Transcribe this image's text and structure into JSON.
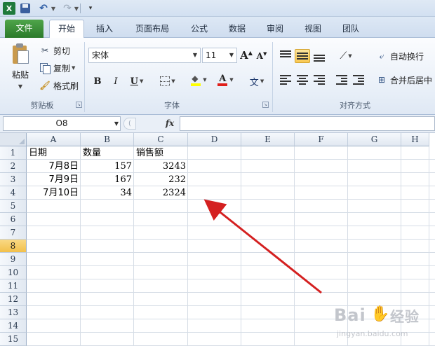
{
  "quick_access": {
    "app_icon": "X",
    "icons": [
      "excel-icon",
      "save-icon",
      "undo-icon",
      "redo-icon",
      "customize-icon"
    ]
  },
  "tabs": [
    {
      "label": "文件",
      "active": false
    },
    {
      "label": "开始",
      "active": true
    },
    {
      "label": "插入",
      "active": false
    },
    {
      "label": "页面布局",
      "active": false
    },
    {
      "label": "公式",
      "active": false
    },
    {
      "label": "数据",
      "active": false
    },
    {
      "label": "审阅",
      "active": false
    },
    {
      "label": "视图",
      "active": false
    },
    {
      "label": "团队",
      "active": false
    }
  ],
  "ribbon": {
    "clipboard": {
      "group_label": "剪贴板",
      "paste_label": "粘贴",
      "cut_label": "剪切",
      "copy_label": "复制",
      "format_painter_label": "格式刷"
    },
    "font": {
      "group_label": "字体",
      "font_name": "宋体",
      "font_size": "11",
      "grow_label": "A",
      "shrink_label": "A",
      "bold_label": "B",
      "italic_label": "I",
      "underline_label": "U",
      "font_color_letter": "A",
      "wen_label": "文",
      "fill_color": "#ffff00",
      "font_color": "#e0201b"
    },
    "alignment": {
      "group_label": "对齐方式",
      "wrap_text_label": "自动换行",
      "merge_center_label": "合并后居中"
    }
  },
  "formula_bar": {
    "name_box": "O8",
    "fx_label": "fx",
    "formula": ""
  },
  "sheet": {
    "columns": [
      "A",
      "B",
      "C",
      "D",
      "E",
      "F",
      "G",
      "H"
    ],
    "rows": [
      "1",
      "2",
      "3",
      "4",
      "5",
      "6",
      "7",
      "8",
      "9",
      "10",
      "11",
      "12",
      "13",
      "14",
      "15"
    ],
    "selected_row": "8",
    "cells": {
      "A1": "日期",
      "B1": "数量",
      "C1": "销售额",
      "A2": "7月8日",
      "B2": "157",
      "C2": "3243",
      "A3": "7月9日",
      "B3": "167",
      "C3": "232",
      "A4": "7月10日",
      "B4": "34",
      "C4": "2324"
    }
  },
  "annotation": {
    "arrow_color": "#d42020"
  },
  "watermark": {
    "main": "Bai",
    "suffix": "经验",
    "url": "jingyan.baidu.com"
  }
}
